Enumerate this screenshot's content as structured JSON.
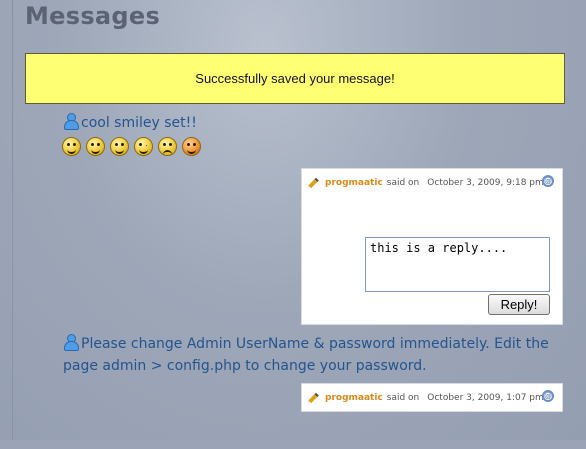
{
  "page": {
    "title": "Messages"
  },
  "notice": {
    "text": "Successfully saved your message!"
  },
  "messages": [
    {
      "text": "cool smiley set!!",
      "smileys": [
        "tongue-smiley-icon",
        "grin-smiley-icon",
        "smile-smiley-icon",
        "wink-smiley-icon",
        "sad-smiley-icon",
        "blush-smiley-icon"
      ],
      "reply": {
        "author": "progmaatic",
        "said_on": "said on",
        "date": "October 3, 2009, 9:18 pm",
        "reply_value": "this is a reply....",
        "reply_button": "Reply!"
      }
    },
    {
      "text": "Please change Admin UserName & password immediately. Edit the page admin > config.php to change your password.",
      "reply": {
        "author": "progmaatic",
        "said_on": "said on",
        "date": "October 3, 2009, 1:07 pm"
      }
    }
  ],
  "colors": {
    "notice_bg": "#ffff73",
    "message_text": "#24548f",
    "author": "#d98a1c"
  },
  "icons": {
    "user": "user-icon",
    "edit": "pencil-icon",
    "email": "at-icon"
  }
}
